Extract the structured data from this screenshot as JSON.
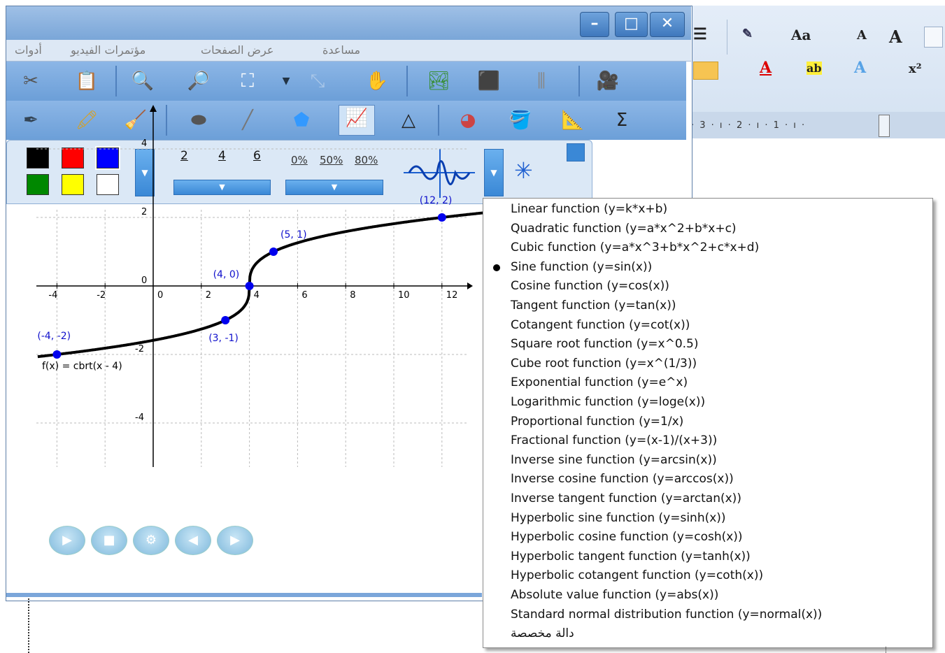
{
  "menubar": {
    "items": [
      "أدوات",
      "مؤتمرات الفيديو",
      "عرض الصفحات",
      "مساعدة"
    ]
  },
  "window_controls": {
    "minimize": "–",
    "maximize": "□",
    "close": "✕"
  },
  "ribbon": {
    "font_label": "Aa",
    "grow_font": "A",
    "shrink_font": "A",
    "superscript": "x²",
    "ruler_marks": "· 3 · ı · 2 · ı · 1 · ı ·",
    "font_color_label": "A",
    "highlight_label": "ab"
  },
  "properties_panel": {
    "colors": [
      "#000000",
      "#ff0000",
      "#0000ff",
      "#008000",
      "#ffff00",
      "#ffffff"
    ],
    "line_widths": [
      "2",
      "4",
      "6"
    ],
    "opacity": [
      "0%",
      "50%",
      "80%"
    ]
  },
  "graph": {
    "function_label": "f(x) = cbrt(x - 4)",
    "x_ticks": [
      "-4",
      "-2",
      "0",
      "2",
      "4",
      "6",
      "8",
      "10",
      "12"
    ],
    "y_ticks": [
      "4",
      "2",
      "0",
      "-2",
      "-4"
    ],
    "points": [
      {
        "label": "(-4, -2)",
        "x": -4,
        "y": -2
      },
      {
        "label": "(3, -1)",
        "x": 3,
        "y": -1
      },
      {
        "label": "(4, 0)",
        "x": 4,
        "y": 0
      },
      {
        "label": "(5, 1)",
        "x": 5,
        "y": 1
      },
      {
        "label": "(12, 2)",
        "x": 12,
        "y": 2
      }
    ]
  },
  "function_menu": {
    "selected_index": 3,
    "items": [
      "Linear function (y=k*x+b)",
      "Quadratic function (y=a*x^2+b*x+c)",
      "Cubic function (y=a*x^3+b*x^2+c*x+d)",
      "Sine function (y=sin(x))",
      "Cosine function (y=cos(x))",
      "Tangent function (y=tan(x))",
      "Cotangent function (y=cot(x))",
      "Square root function (y=x^0.5)",
      "Cube root function (y=x^(1/3))",
      "Exponential function (y=e^x)",
      "Logarithmic function (y=loge(x))",
      "Proportional function (y=1/x)",
      "Fractional function (y=(x-1)/(x+3))",
      "Inverse sine function (y=arcsin(x))",
      "Inverse cosine function (y=arccos(x))",
      "Inverse tangent function (y=arctan(x))",
      "Hyperbolic sine function (y=sinh(x))",
      "Hyperbolic cosine function (y=cosh(x))",
      "Hyperbolic tangent function (y=tanh(x))",
      "Hyperbolic cotangent function (y=coth(x))",
      "Absolute value function (y=abs(x))",
      "Standard normal distribution function (y=normal(x))",
      "دالة مخصصة"
    ]
  }
}
